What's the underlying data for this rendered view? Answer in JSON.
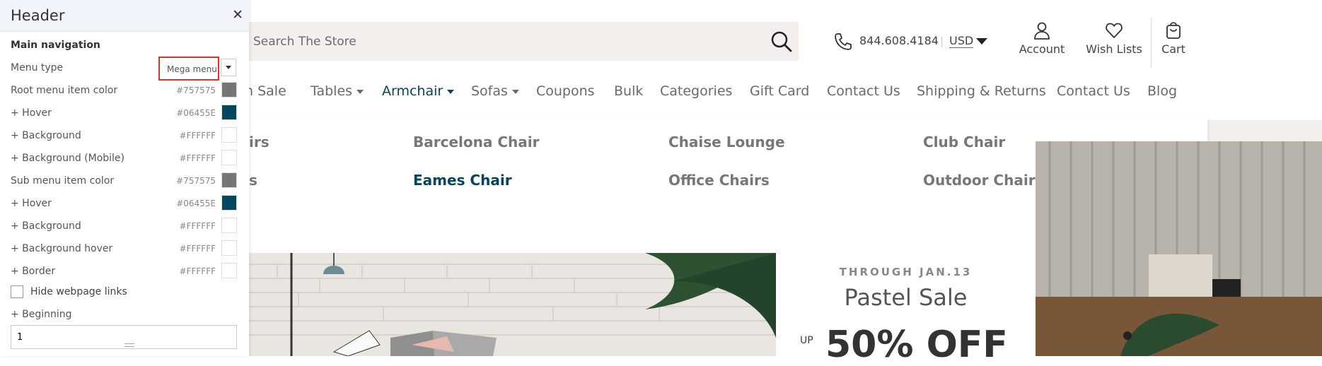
{
  "panel": {
    "title": "Header",
    "close_icon": "close-icon",
    "section_title": "Main navigation",
    "menu_type_label": "Menu type",
    "menu_type_value": "Mega menu",
    "rows": [
      {
        "label": "Root menu item color",
        "value": "#757575",
        "color": "#757575"
      },
      {
        "label": "+ Hover",
        "value": "#06455E",
        "color": "#06455E"
      },
      {
        "label": "+ Background",
        "value": "#FFFFFF",
        "color": "#FFFFFF"
      },
      {
        "label": "+ Background (Mobile)",
        "value": "#FFFFFF",
        "color": "#FFFFFF"
      },
      {
        "label": "Sub menu item color",
        "value": "#757575",
        "color": "#757575"
      },
      {
        "label": "+ Hover",
        "value": "#06455E",
        "color": "#06455E"
      },
      {
        "label": "+ Background",
        "value": "#FFFFFF",
        "color": "#FFFFFF"
      },
      {
        "label": "+ Background hover",
        "value": "#FFFFFF",
        "color": "#FFFFFF"
      },
      {
        "label": "+ Border",
        "value": "#FFFFFF",
        "color": "#FFFFFF"
      }
    ],
    "hide_links_label": "Hide webpage links",
    "hide_links_checked": false,
    "beginning_label": "+ Beginning",
    "beginning_value": "1"
  },
  "header": {
    "search_placeholder": "Search The Store",
    "phone": "844.608.4184",
    "separator": "|",
    "currency": "USD",
    "account_label": "Account",
    "wishlists_label": "Wish Lists",
    "cart_label": "Cart"
  },
  "nav": {
    "items": [
      {
        "label": "n Sale",
        "dropdown": false
      },
      {
        "label": "Tables",
        "dropdown": true
      },
      {
        "label": "Armchair",
        "dropdown": true,
        "active": true
      },
      {
        "label": "Sofas",
        "dropdown": true
      },
      {
        "label": "Coupons",
        "dropdown": false
      },
      {
        "label": "Bulk",
        "dropdown": false
      },
      {
        "label": "Categories",
        "dropdown": false
      },
      {
        "label": "Gift Card",
        "dropdown": false
      },
      {
        "label": "Contact Us",
        "dropdown": false
      },
      {
        "label": "Shipping & Returns",
        "dropdown": false
      },
      {
        "label": "Contact Us",
        "dropdown": false
      },
      {
        "label": "Blog",
        "dropdown": false
      }
    ]
  },
  "mega_menu": {
    "links": [
      {
        "label": "irs"
      },
      {
        "label": "Barcelona Chair"
      },
      {
        "label": "Chaise Lounge"
      },
      {
        "label": "Club Chair"
      },
      {
        "label": "s"
      },
      {
        "label": "Eames Chair",
        "active": true
      },
      {
        "label": "Office Chairs"
      },
      {
        "label": "Outdoor Chairs"
      }
    ]
  },
  "banner": {
    "line1": "THROUGH JAN.13",
    "line2": "Pastel Sale",
    "up": "UP",
    "big": "50% OFF"
  },
  "colors": {
    "accent": "#06455E",
    "menu_text": "#757575",
    "search_bg": "#F2EFEC",
    "highlight_border": "#E03030"
  }
}
